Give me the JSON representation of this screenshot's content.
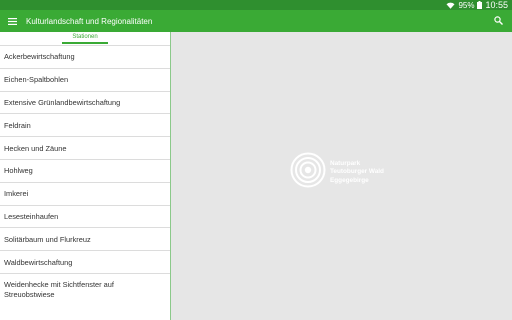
{
  "status_bar": {
    "wifi_icon": "wifi-icon",
    "battery_percent": "95%",
    "battery_icon": "battery-icon",
    "time": "10:55"
  },
  "app_bar": {
    "menu_icon": "menu-icon",
    "title": "Kulturlandschaft und Regionalitäten",
    "search_icon": "search-icon"
  },
  "sidebar": {
    "tab_label": "Stationen",
    "items": [
      {
        "label": "Ackerbewirtschaftung"
      },
      {
        "label": "Eichen-Spaltbohlen"
      },
      {
        "label": "Extensive Grünlandbewirtschaftung"
      },
      {
        "label": "Feldrain"
      },
      {
        "label": "Hecken und Zäune"
      },
      {
        "label": "Hohlweg"
      },
      {
        "label": "Imkerei"
      },
      {
        "label": "Lesesteinhaufen"
      },
      {
        "label": "Solitärbaum und Flurkreuz"
      },
      {
        "label": "Waldbewirtschaftung"
      },
      {
        "label_line1": "Weidenhecke mit Sichtfenster auf",
        "label_line2": "Streuobstwiese"
      }
    ]
  },
  "main": {
    "logo": {
      "line1": "Naturpark",
      "line2": "Teutoburger Wald",
      "line3": "Eggegebirge"
    }
  },
  "colors": {
    "status_bar": "#2f8f2f",
    "app_bar": "#3aaa35",
    "accent": "#3aaa35",
    "background": "#e6e6e6"
  }
}
